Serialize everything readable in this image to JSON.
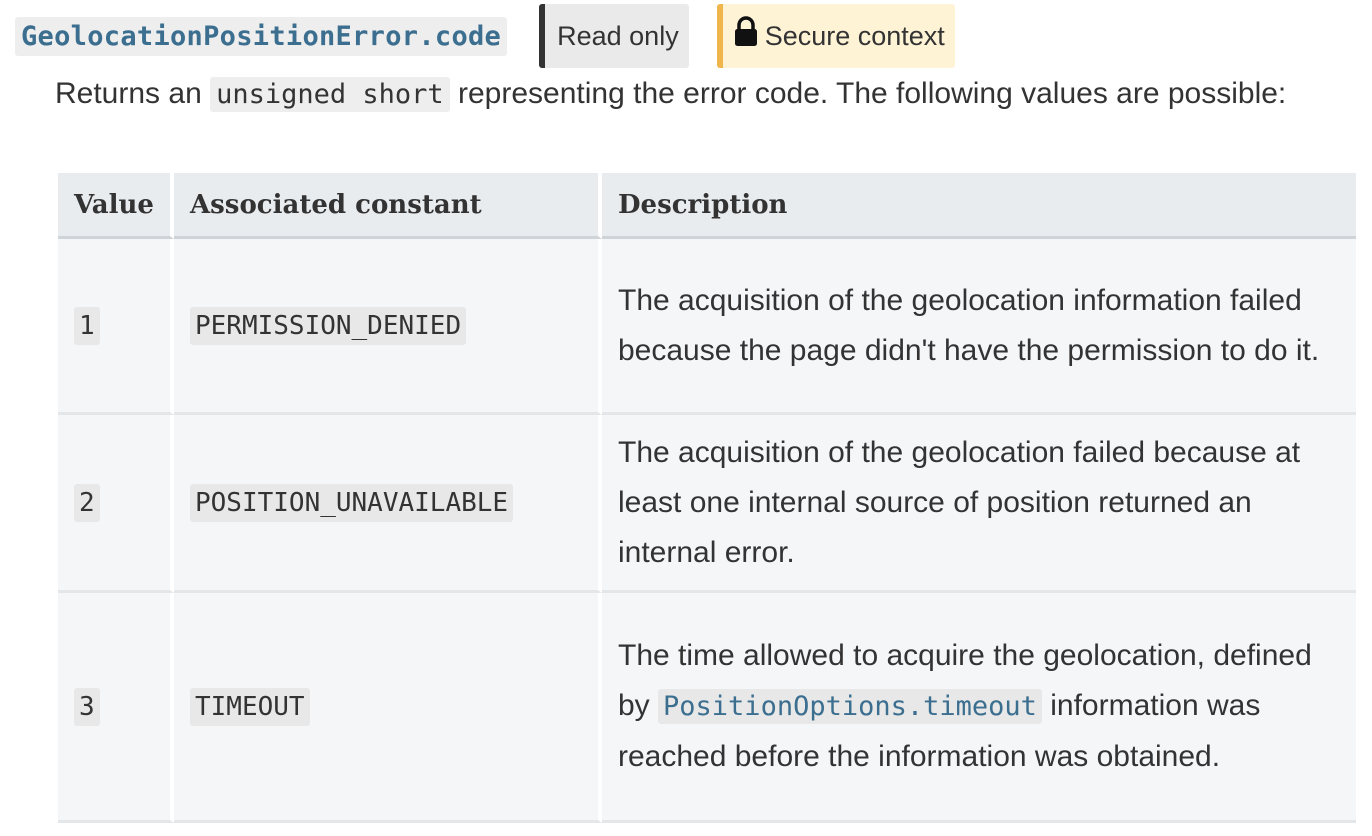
{
  "header": {
    "property_name": "GeolocationPositionError.code",
    "badge_readonly": "Read only",
    "badge_secure": "Secure context"
  },
  "description": {
    "prefix": "Returns an ",
    "type_code": "unsigned short",
    "suffix": " representing the error code. The following values are possible:"
  },
  "table": {
    "headers": [
      "Value",
      "Associated constant",
      "Description"
    ],
    "rows": [
      {
        "value": "1",
        "constant": "PERMISSION_DENIED",
        "description": "The acquisition of the geolocation information failed because the page didn't have the permission to do it."
      },
      {
        "value": "2",
        "constant": "POSITION_UNAVAILABLE",
        "description": "The acquisition of the geolocation failed because at least one internal source of position returned an internal error."
      },
      {
        "value": "3",
        "constant": "TIMEOUT",
        "description_prefix": "The time allowed to acquire the geolocation, defined by ",
        "description_link": "PositionOptions.timeout",
        "description_suffix": " information was reached before the information was obtained."
      }
    ]
  },
  "colors": {
    "link": "#3b6e8f",
    "readonly_border": "#333333",
    "secure_border": "#f0b64c",
    "secure_bg": "#fff3d6"
  }
}
